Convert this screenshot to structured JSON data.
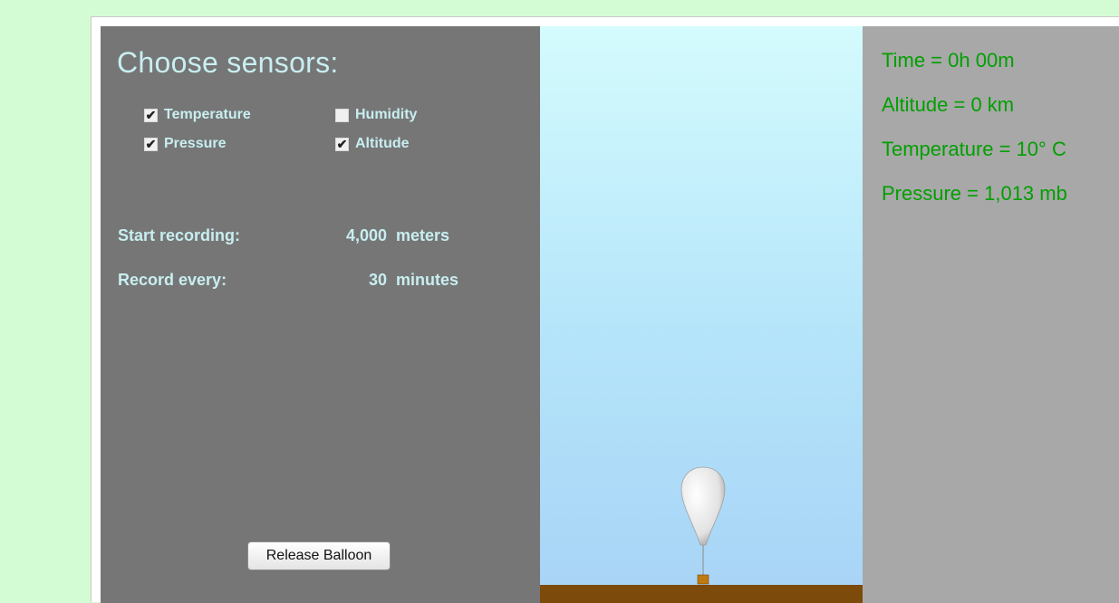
{
  "control_panel": {
    "title": "Choose sensors:",
    "sensors": [
      {
        "label": "Temperature",
        "checked": true
      },
      {
        "label": "Humidity",
        "checked": false
      },
      {
        "label": "Pressure",
        "checked": true
      },
      {
        "label": "Altitude",
        "checked": true
      }
    ],
    "start_recording": {
      "label": "Start recording:",
      "value": "4,000",
      "unit": "meters"
    },
    "record_every": {
      "label": "Record every:",
      "value": "30",
      "unit": "minutes"
    },
    "release_button_label": "Release Balloon"
  },
  "readouts": {
    "time": "Time = 0h 00m",
    "altitude": "Altitude = 0 km",
    "temperature": "Temperature = 10° C",
    "pressure": "Pressure = 1,013 mb"
  },
  "colors": {
    "page_background": "#d4fcd4",
    "control_panel": "#767676",
    "control_text": "#c8eef0",
    "readout_panel": "#a8a8a8",
    "readout_text": "#00a000",
    "ground": "#7c4a0a",
    "sky_top": "#d4fbfd",
    "sky_bottom": "#a8d3f6"
  }
}
